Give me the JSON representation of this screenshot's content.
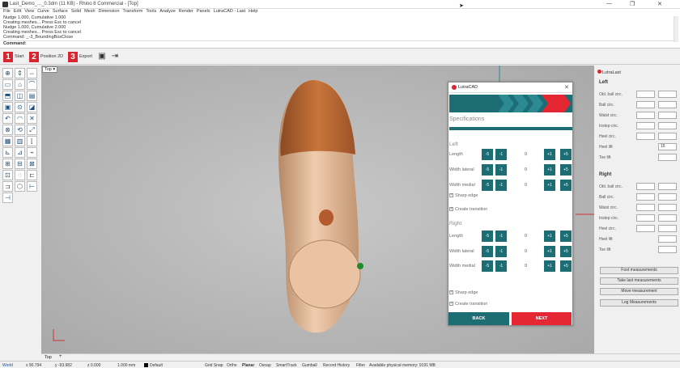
{
  "window": {
    "title": "Last_Demo_..._0.3dm (11 KB) - Rhino 8 Commercial - [Top]",
    "controls": [
      "—",
      "❐",
      "✕"
    ]
  },
  "menu": [
    "File",
    "Edit",
    "View",
    "Curve",
    "Surface",
    "Solid",
    "Mesh",
    "Dimension",
    "Transform",
    "Tools",
    "Analyze",
    "Render",
    "Panels",
    "LutraCAD - Last",
    "Help"
  ],
  "command_history": [
    "Nudge 1.000, Cumulative 1.000",
    "Creating meshes... Press Esc to cancel",
    "Nudge 1.000, Cumulative 2.000",
    "Creating meshes... Press Esc to cancel",
    "Command: _-3_BoundingBoxClose"
  ],
  "command_prompt": "Command:",
  "steps": [
    {
      "num": "1",
      "label": "Start"
    },
    {
      "num": "2",
      "label": "Position 2D"
    },
    {
      "num": "3",
      "label": "Export"
    }
  ],
  "viewport": {
    "name": "Top",
    "tab": "Top"
  },
  "dialog": {
    "title": "LutraCAD",
    "section": "Specifications",
    "left": {
      "heading": "Left",
      "rows": [
        {
          "label": "Length",
          "value": "0"
        },
        {
          "label": "Width lateral",
          "value": "0"
        },
        {
          "label": "Width medial",
          "value": "0"
        }
      ],
      "sharp_edge": "Sharp edge",
      "create_transition": "Create transition"
    },
    "right": {
      "heading": "Right",
      "rows": [
        {
          "label": "Length",
          "value": "0"
        },
        {
          "label": "Width lateral",
          "value": "0"
        },
        {
          "label": "Width medial",
          "value": "0"
        }
      ],
      "sharp_edge": "Sharp edge",
      "create_transition": "Create transition"
    },
    "step_buttons": [
      "-5",
      "-1",
      "+1",
      "+5"
    ],
    "back": "BACK",
    "next": "NEXT"
  },
  "lutralast": {
    "title": "LutraLast",
    "left_heading": "Left",
    "right_heading": "Right",
    "left_fields": [
      {
        "label": "Obl. ball circ.",
        "a": "",
        "b": ""
      },
      {
        "label": "Ball circ.",
        "a": "",
        "b": ""
      },
      {
        "label": "Waist circ.",
        "a": "",
        "b": ""
      },
      {
        "label": "Instep circ.",
        "a": "",
        "b": ""
      },
      {
        "label": "Heel circ.",
        "a": "",
        "b": ""
      },
      {
        "label": "Heel lift",
        "a": null,
        "b": "15"
      },
      {
        "label": "Toe lift",
        "a": null,
        "b": ""
      }
    ],
    "right_fields": [
      {
        "label": "Obl. ball circ.",
        "a": "",
        "b": ""
      },
      {
        "label": "Ball circ.",
        "a": "",
        "b": ""
      },
      {
        "label": "Waist circ.",
        "a": "",
        "b": ""
      },
      {
        "label": "Instep circ.",
        "a": "",
        "b": ""
      },
      {
        "label": "Heel circ.",
        "a": "",
        "b": ""
      },
      {
        "label": "Heel lift",
        "a": null,
        "b": ""
      },
      {
        "label": "Toe lift",
        "a": null,
        "b": ""
      }
    ],
    "buttons": [
      "Foot measurements",
      "Take last measurements",
      "Move measurement",
      "Log Measurements"
    ]
  },
  "status": {
    "world": "World",
    "x": "x 90.794",
    "y": "y -93.982",
    "z": "z 0.000",
    "units": "1.000 mm",
    "layer": "Default",
    "toggles": [
      "Grid Snap",
      "Ortho",
      "Planar",
      "Osnap",
      "SmartTrack",
      "Gumball",
      "Record History",
      "Filter"
    ],
    "memory": "Available physical memory: 9191 MB"
  },
  "colors": {
    "teal": "#1d6d75",
    "red": "#e52633",
    "last_brown": "#c1662f",
    "last_skin": "#edc2a0"
  }
}
